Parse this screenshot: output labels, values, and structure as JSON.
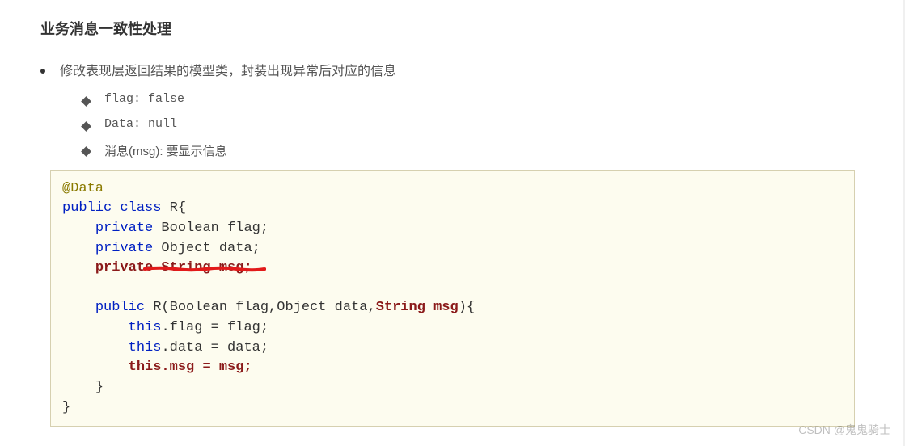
{
  "heading": "业务消息一致性处理",
  "bullets": {
    "lvl1": "修改表现层返回结果的模型类，封装出现异常后对应的信息",
    "lvl2": [
      "flag: false",
      "Data: null",
      "消息(msg): 要显示信息"
    ]
  },
  "code": {
    "line1": {
      "annotation": "@Data"
    },
    "line2": {
      "kw1": "public",
      "kw2": "class",
      "rest": " R{"
    },
    "line3": {
      "indent": "    ",
      "kw": "private",
      "type": " Boolean ",
      "field": "flag",
      "semi": ";"
    },
    "line4": {
      "indent": "    ",
      "kw": "private",
      "type": " Object ",
      "field": "data",
      "semi": ";"
    },
    "line5": {
      "indent": "    ",
      "text": "private String msg;"
    },
    "line6": {
      "indent": "    ",
      "kw": "public",
      "mid": " R(Boolean flag,Object data,",
      "strong": "String msg",
      "end": "){"
    },
    "line7": {
      "indent": "        ",
      "this": "this",
      "rest": ".flag = flag;"
    },
    "line8": {
      "indent": "        ",
      "this": "this",
      "rest": ".data = data;"
    },
    "line9": {
      "indent": "        ",
      "text": "this.msg = msg;"
    },
    "line10": {
      "indent": "    ",
      "text": "}"
    },
    "line11": {
      "text": "}"
    }
  },
  "watermark": "CSDN @鬼鬼骑士"
}
